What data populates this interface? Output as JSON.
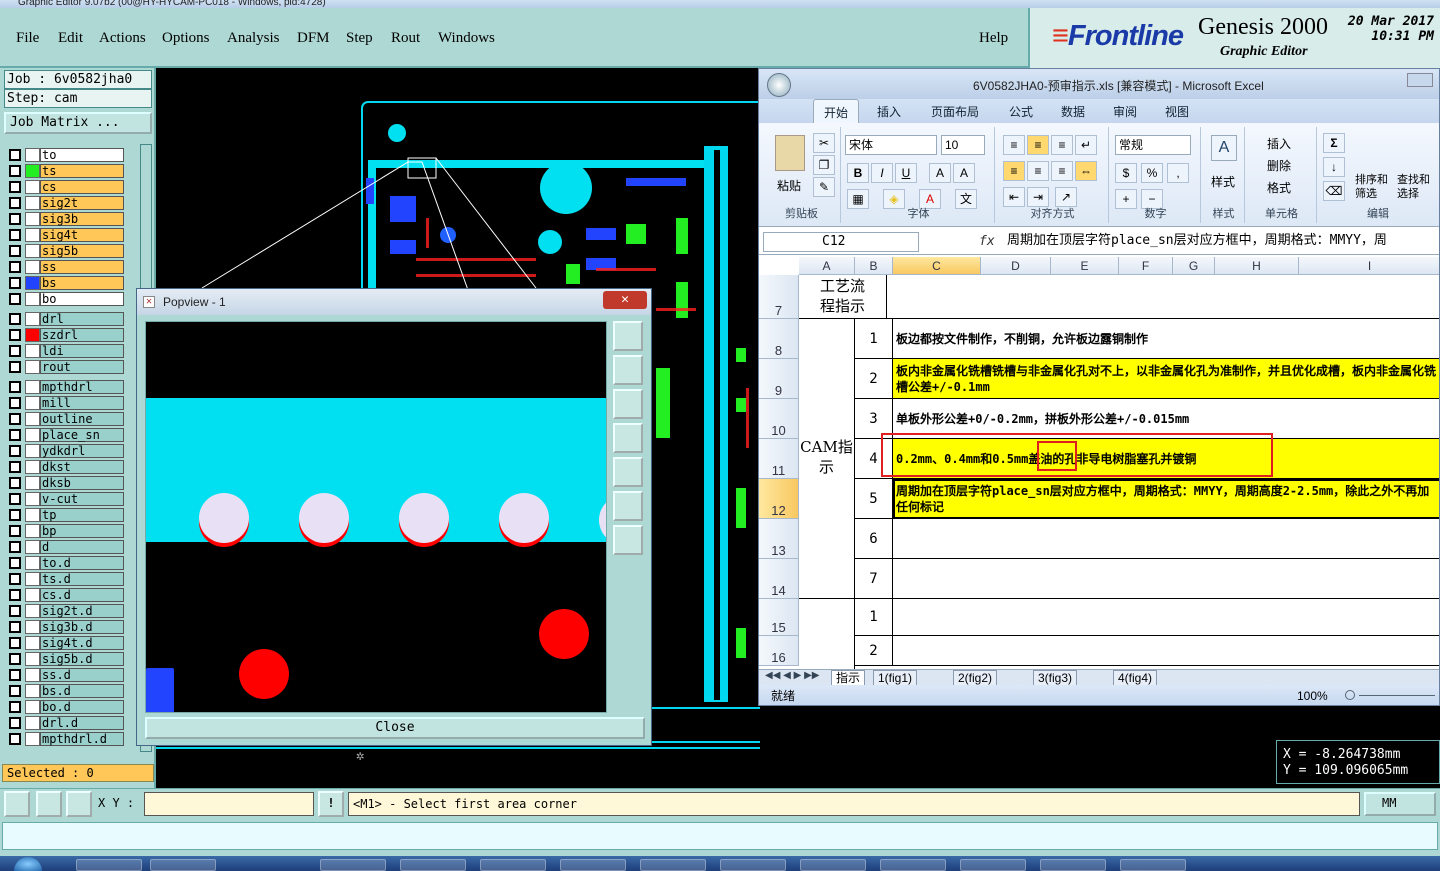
{
  "window_title": "Graphic Editor 9.07b2 (00@HY-HYCAM-PC018 - Windows, pid:4728)",
  "menu": [
    "File",
    "Edit",
    "Actions",
    "Options",
    "Analysis",
    "DFM",
    "Step",
    "Rout",
    "Windows"
  ],
  "help_label": "Help",
  "logo": {
    "brand": "Frontline",
    "product": "Genesis 2000",
    "subtitle": "Graphic Editor",
    "date": "20 Mar 2017",
    "time": "10:31 PM"
  },
  "job": {
    "job_label": "Job : 6v0582jha0",
    "step_label": "Step: cam",
    "matrix_button": "Job Matrix ..."
  },
  "layers_board": [
    "to",
    "ts",
    "cs",
    "sig2t",
    "sig3b",
    "sig4t",
    "sig5b",
    "ss",
    "bs",
    "bo"
  ],
  "layers_drill": [
    "drl",
    "szdrl",
    "ldi",
    "rout"
  ],
  "layers_misc": [
    "mpthdrl",
    "mill",
    "outline",
    "place_sn",
    "ydkdrl",
    "dkst",
    "dksb",
    "v-cut",
    "tp",
    "bp",
    "d",
    "to.d",
    "ts.d",
    "cs.d",
    "sig2t.d",
    "sig3b.d",
    "sig4t.d",
    "sig5b.d",
    "ss.d",
    "bs.d",
    "bo.d",
    "drl.d",
    "mpthdrl.d"
  ],
  "selected_label": "Selected : 0",
  "popview": {
    "title": "Popview - 1",
    "close_x": "✕",
    "close_button": "Close"
  },
  "excel": {
    "title": "6V0582JHA0-预审指示.xls  [兼容模式] - Microsoft Excel",
    "tabs": [
      "开始",
      "插入",
      "页面布局",
      "公式",
      "数据",
      "审阅",
      "视图"
    ],
    "groups": {
      "clipboard": "剪贴板",
      "font": "字体",
      "align": "对齐方式",
      "number": "数字",
      "styles": "样式",
      "cells": "单元格",
      "edit": "编辑"
    },
    "paste": "粘贴",
    "font_name": "宋体",
    "font_size": "10",
    "number_format": "常规",
    "style_label": "样式",
    "insert_label": "插入",
    "delete_label": "删除",
    "format_label": "格式",
    "sort_label": "排序和筛选",
    "find_label": "查找和选择",
    "name_box": "C12",
    "formula": "周期加在顶层字符place_sn层对应方框中，周期格式：MMYY，周",
    "columns": [
      "A",
      "B",
      "C",
      "D",
      "E",
      "F",
      "G",
      "H",
      "I"
    ],
    "rows": [
      {
        "num": "7",
        "a": "工艺流程指示",
        "b": "",
        "text": ""
      },
      {
        "num": "8",
        "a": "",
        "b": "1",
        "text": "板边都按文件制作，不削铜，允许板边露铜制作"
      },
      {
        "num": "9",
        "a": "",
        "b": "2",
        "text": "板内非金属化铣槽铣槽与非金属化孔对不上，以非金属化孔为准制作，并且优化成槽，板内非金属化铣槽公差+/-0.1mm"
      },
      {
        "num": "10",
        "a": "",
        "b": "3",
        "text": "单板外形公差+0/-0.2mm，拼板外形公差+/-0.015mm"
      },
      {
        "num": "11",
        "a": "CAM指示",
        "b": "4",
        "text": "0.2mm、0.4mm和0.5mm盖油的孔非导电树脂塞孔并镀铜"
      },
      {
        "num": "12",
        "a": "",
        "b": "5",
        "text": "周期加在顶层字符place_sn层对应方框中，周期格式：MMYY，周期高度2-2.5mm，除此之外不再加任何标记"
      },
      {
        "num": "13",
        "a": "",
        "b": "6",
        "text": ""
      },
      {
        "num": "14",
        "a": "",
        "b": "7",
        "text": ""
      },
      {
        "num": "15",
        "a": "",
        "b": "1",
        "text": ""
      },
      {
        "num": "16",
        "a": "",
        "b": "2",
        "text": ""
      }
    ],
    "sheets": [
      "指示",
      "1(fig1)",
      "2(fig2)",
      "3(fig3)",
      "4(fig4)"
    ],
    "status": "就绪",
    "zoom": "100%"
  },
  "coords": {
    "x": "X  = -8.264738mm",
    "y": "Y  = 109.096065mm"
  },
  "bottom": {
    "xy_label": "X Y :",
    "prompt": "<M1> - Select first area corner",
    "units": "MM"
  },
  "colors": {
    "panel": "#aed8d4",
    "board_layer": "#ffc658",
    "cyan": "#00e0f0",
    "green": "#22ee22",
    "red": "#ff0000",
    "highlight": "#ffff00"
  }
}
